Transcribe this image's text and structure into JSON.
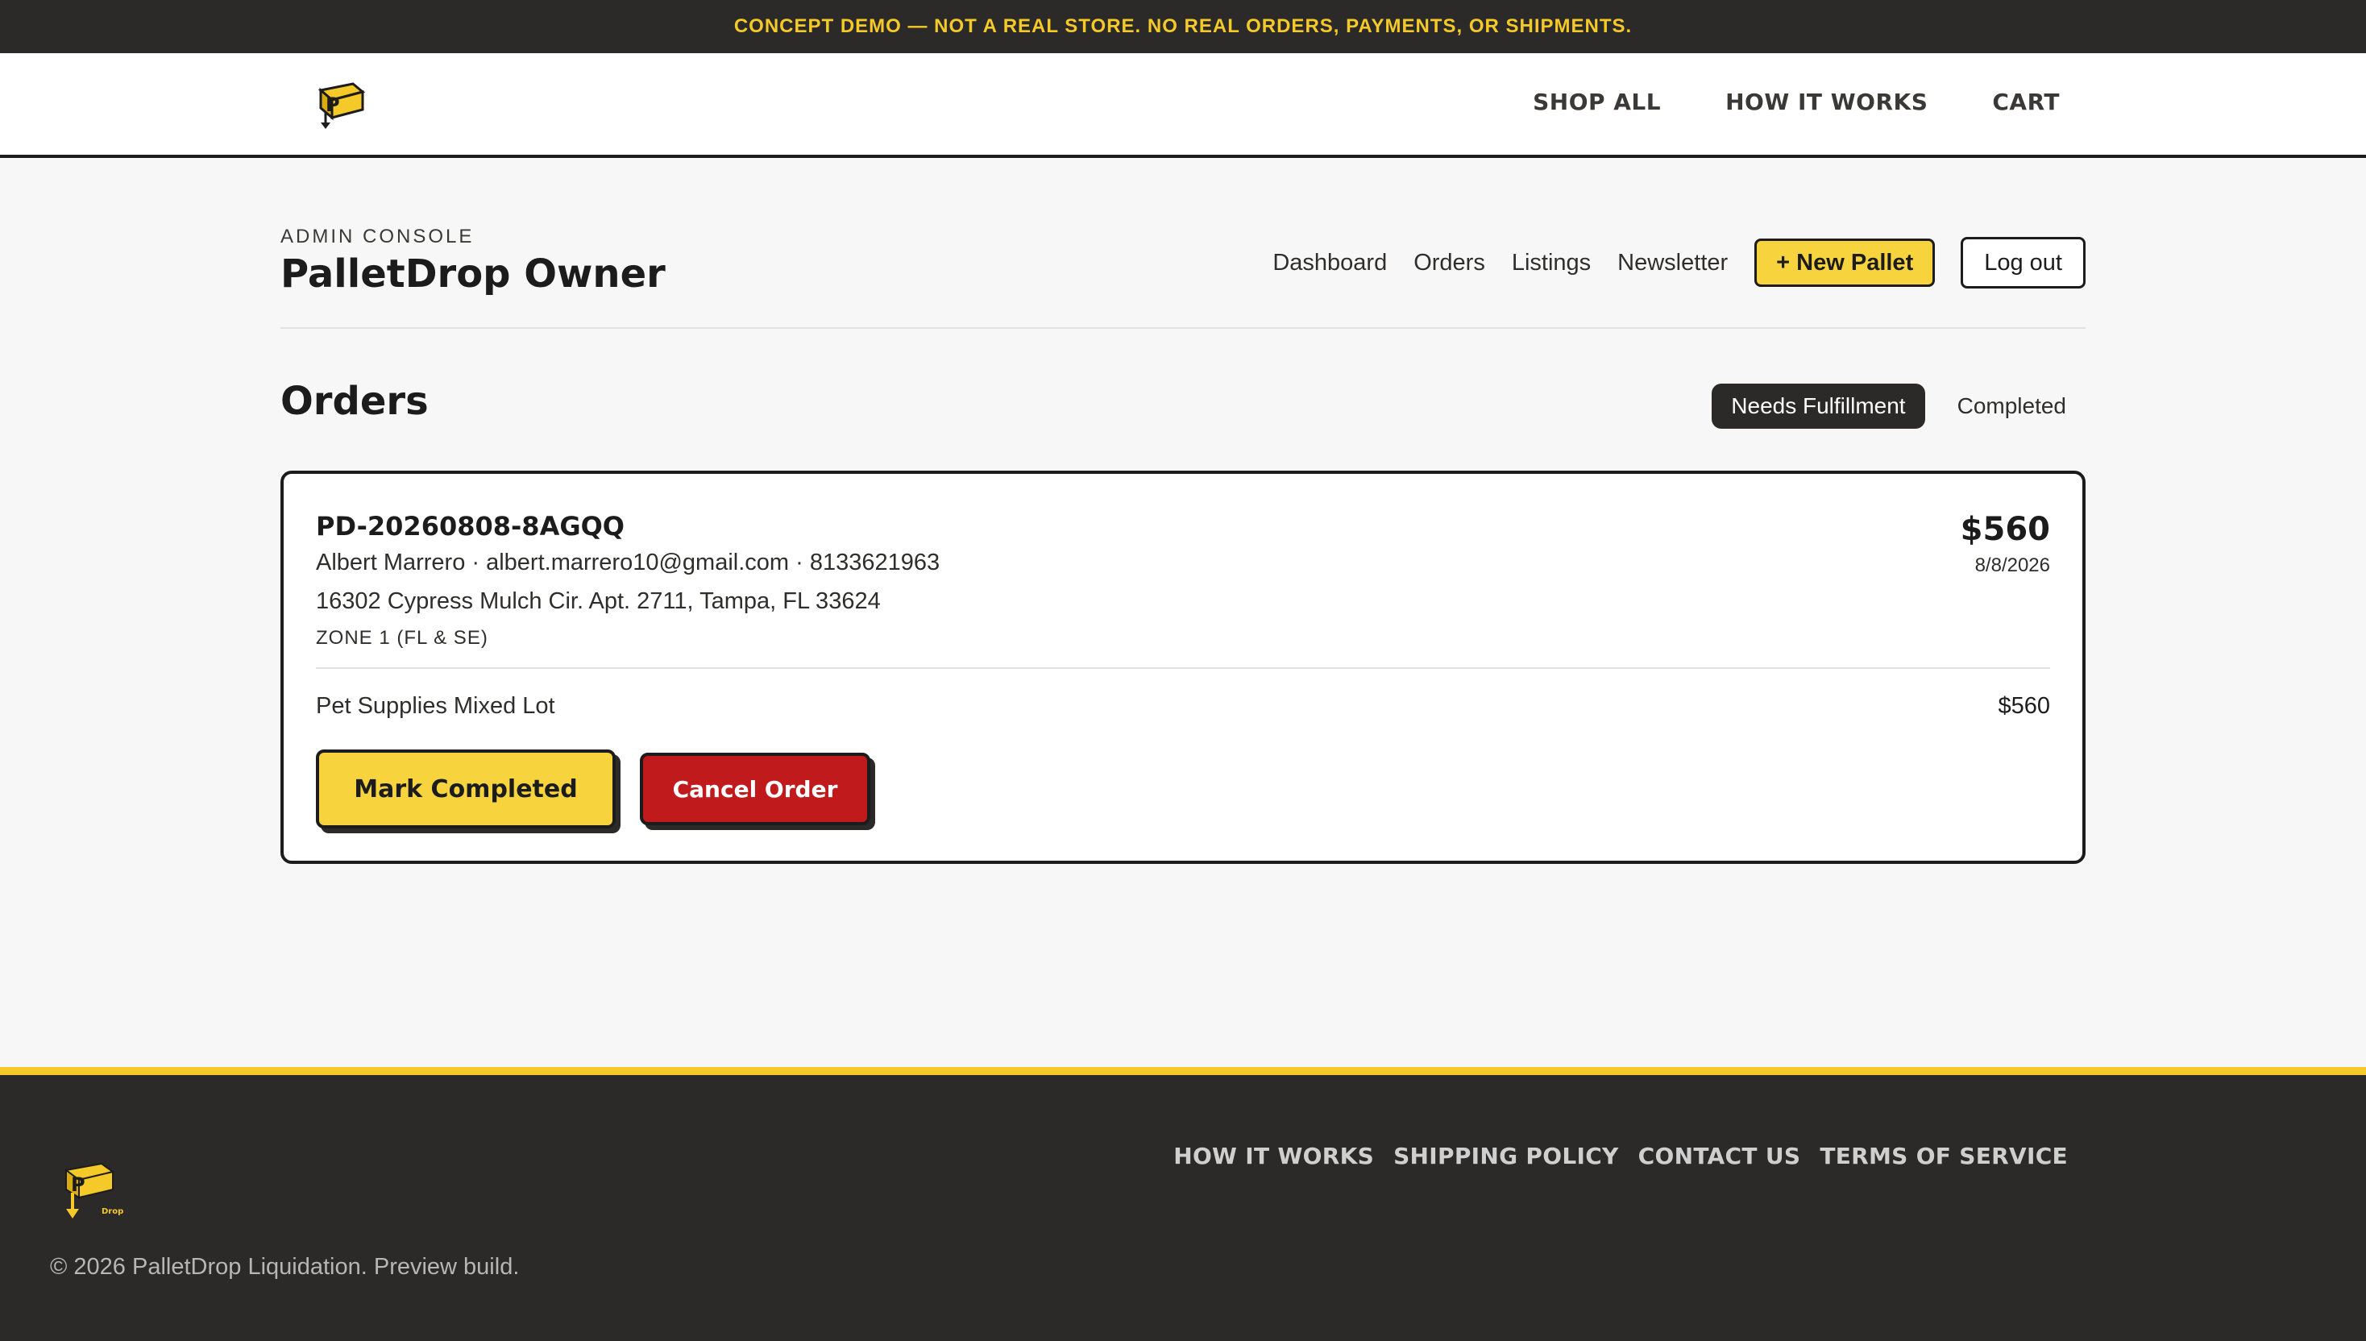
{
  "banner": {
    "text": "CONCEPT DEMO — NOT A REAL STORE. NO REAL ORDERS, PAYMENTS, OR SHIPMENTS."
  },
  "brand": {
    "logo_icon": "palletdrop-logo-icon",
    "accent": "#f5c928",
    "dark": "#2b2a28",
    "danger": "#c01a1c"
  },
  "topnav": {
    "items": [
      {
        "label": "SHOP ALL"
      },
      {
        "label": "HOW IT WORKS"
      },
      {
        "label": "CART"
      }
    ]
  },
  "admin": {
    "eyebrow": "ADMIN CONSOLE",
    "title": "PalletDrop Owner",
    "nav": [
      {
        "label": "Dashboard"
      },
      {
        "label": "Orders"
      },
      {
        "label": "Listings"
      },
      {
        "label": "Newsletter"
      }
    ],
    "new_pallet_label": "+ New Pallet",
    "logout_label": "Log out"
  },
  "orders": {
    "title": "Orders",
    "filters": {
      "active": "Needs Fulfillment",
      "other": "Completed"
    },
    "list": [
      {
        "id": "PD-20260808-8AGQQ",
        "contact": "Albert Marrero · albert.marrero10@gmail.com · 8133621963",
        "address": "16302 Cypress Mulch Cir. Apt. 2711, Tampa, FL 33624",
        "zone": "ZONE 1 (FL & SE)",
        "total": "$560",
        "date": "8/8/2026",
        "items": [
          {
            "name": "Pet Supplies Mixed Lot",
            "price": "$560"
          }
        ],
        "complete_label": "Mark Completed",
        "cancel_label": "Cancel Order"
      }
    ]
  },
  "footer": {
    "links": [
      {
        "label": "HOW IT WORKS"
      },
      {
        "label": "SHIPPING POLICY"
      },
      {
        "label": "CONTACT US"
      },
      {
        "label": "TERMS OF SERVICE"
      }
    ],
    "copyright": "© 2026 PalletDrop Liquidation. Preview build.",
    "logo_text": "Drop"
  }
}
